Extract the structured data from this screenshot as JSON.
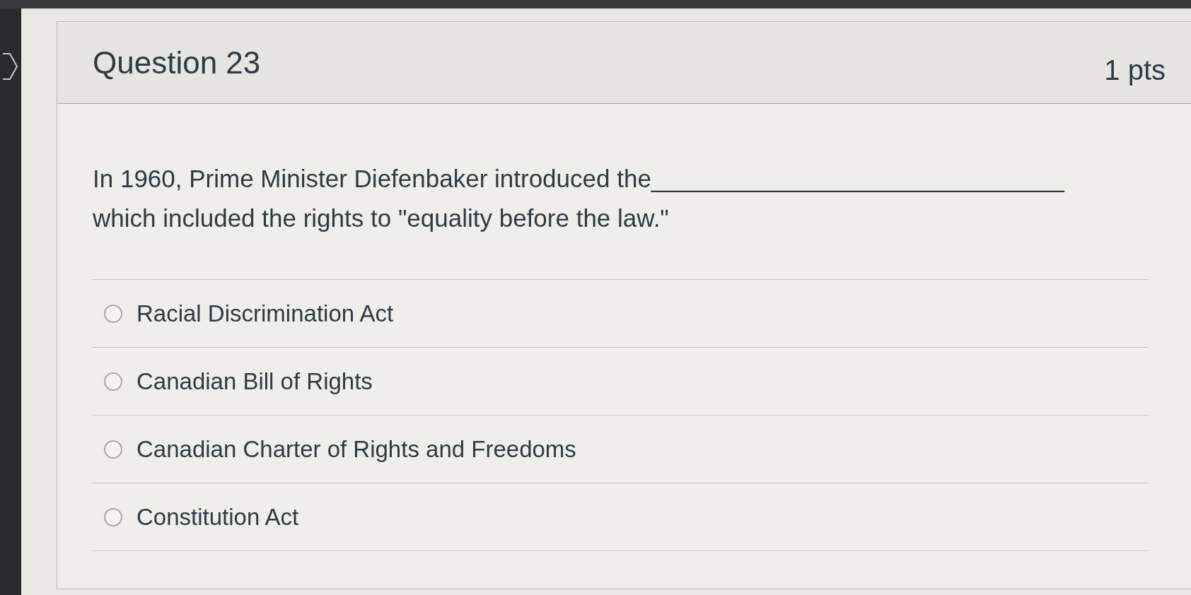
{
  "question": {
    "title": "Question 23",
    "points": "1 pts",
    "text": "In 1960, Prime Minister Diefenbaker introduced the______________________________ which included the rights to \"equality before the law.\""
  },
  "answers": [
    {
      "label": "Racial Discrimination Act",
      "selected": false
    },
    {
      "label": "Canadian Bill of Rights",
      "selected": false
    },
    {
      "label": "Canadian Charter of Rights and Freedoms",
      "selected": false
    },
    {
      "label": "Constitution Act",
      "selected": false
    }
  ]
}
